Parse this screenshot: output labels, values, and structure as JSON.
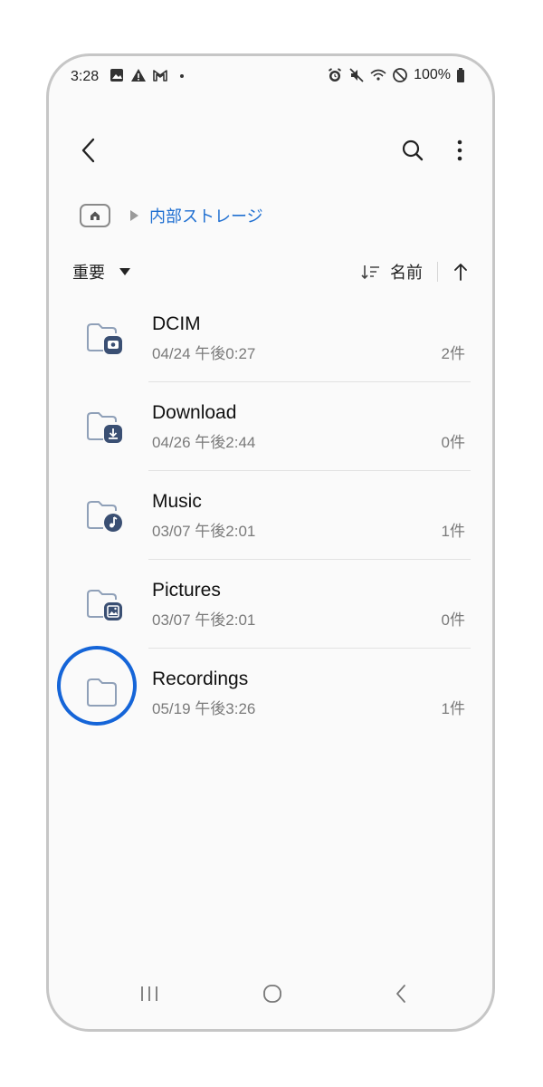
{
  "status_bar": {
    "time": "3:28",
    "battery": "100%",
    "left_icons": [
      "gallery-icon",
      "warning-icon",
      "gmail-icon",
      "dot-icon"
    ],
    "right_icons": [
      "alarm-icon",
      "mute-icon",
      "wifi-icon",
      "dnd-icon",
      "battery-icon"
    ]
  },
  "breadcrumb": {
    "home_icon": "home-icon",
    "current": "内部ストレージ"
  },
  "filter": {
    "label": "重要"
  },
  "sort": {
    "field": "名前",
    "direction_icon": "arrow-up-icon"
  },
  "files": [
    {
      "name": "DCIM",
      "date": "04/24 午後0:27",
      "count": "2件",
      "icon": "camera-folder-icon"
    },
    {
      "name": "Download",
      "date": "04/26 午後2:44",
      "count": "0件",
      "icon": "download-folder-icon"
    },
    {
      "name": "Music",
      "date": "03/07 午後2:01",
      "count": "1件",
      "icon": "music-folder-icon"
    },
    {
      "name": "Pictures",
      "date": "03/07 午後2:01",
      "count": "0件",
      "icon": "pictures-folder-icon"
    },
    {
      "name": "Recordings",
      "date": "05/19 午後3:26",
      "count": "1件",
      "icon": "folder-icon"
    }
  ],
  "colors": {
    "accent": "#1f6fd1",
    "highlight": "#1565d8",
    "folder_badge": "#3a4f73",
    "folder_outline": "#8fa0b8"
  }
}
